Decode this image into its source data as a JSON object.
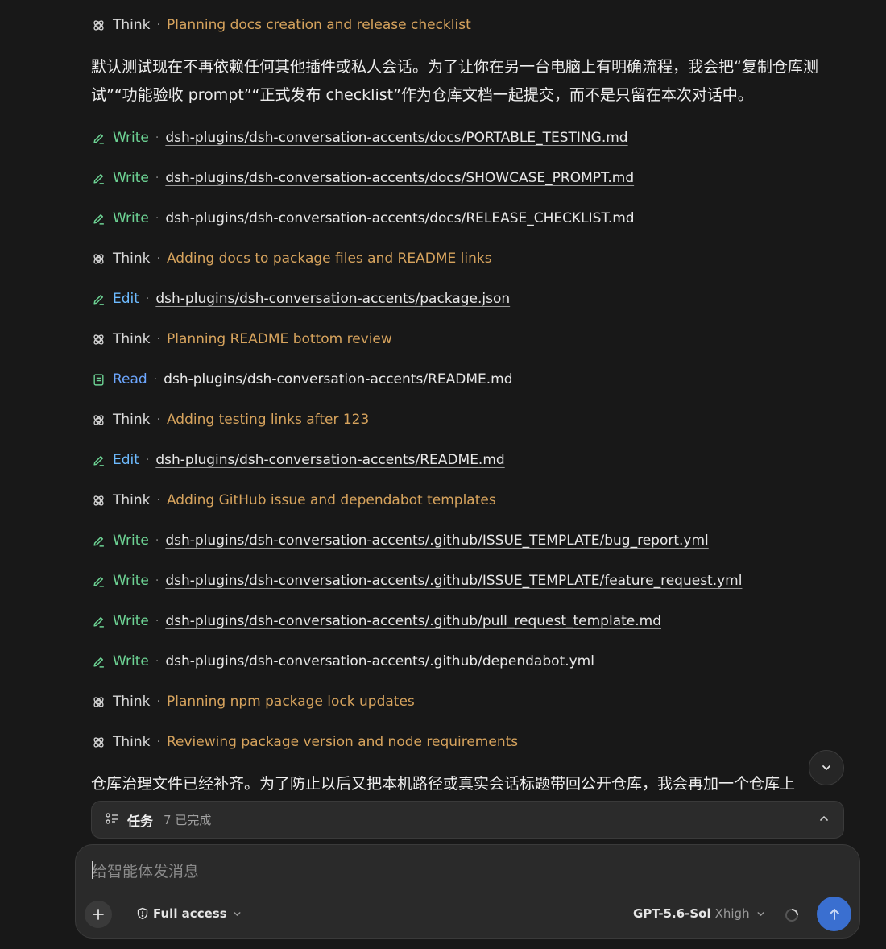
{
  "labels": {
    "write": "Write",
    "edit": "Edit",
    "read": "Read",
    "think": "Think",
    "sep": "·"
  },
  "log": {
    "top_think": "Planning docs creation and release checklist",
    "para1": "默认测试现在不再依赖任何其他插件或私人会话。为了让你在另一台电脑上有明确流程，我会把“复制仓库测试”“功能验收 prompt”“正式发布 checklist”作为仓库文档一起提交，而不是只留在本次对话中。",
    "items": [
      {
        "verb": "Write",
        "text": "dsh-plugins/dsh-conversation-accents/docs/PORTABLE_TESTING.md"
      },
      {
        "verb": "Write",
        "text": "dsh-plugins/dsh-conversation-accents/docs/SHOWCASE_PROMPT.md"
      },
      {
        "verb": "Write",
        "text": "dsh-plugins/dsh-conversation-accents/docs/RELEASE_CHECKLIST.md"
      },
      {
        "verb": "Think",
        "text": "Adding docs to package files and README links"
      },
      {
        "verb": "Edit",
        "text": "dsh-plugins/dsh-conversation-accents/package.json"
      },
      {
        "verb": "Think",
        "text": "Planning README bottom review"
      },
      {
        "verb": "Read",
        "text": "dsh-plugins/dsh-conversation-accents/README.md"
      },
      {
        "verb": "Think",
        "text": "Adding testing links after 123"
      },
      {
        "verb": "Edit",
        "text": "dsh-plugins/dsh-conversation-accents/README.md"
      },
      {
        "verb": "Think",
        "text": "Adding GitHub issue and dependabot templates"
      },
      {
        "verb": "Write",
        "text": "dsh-plugins/dsh-conversation-accents/.github/ISSUE_TEMPLATE/bug_report.yml"
      },
      {
        "verb": "Write",
        "text": "dsh-plugins/dsh-conversation-accents/.github/ISSUE_TEMPLATE/feature_request.yml"
      },
      {
        "verb": "Write",
        "text": "dsh-plugins/dsh-conversation-accents/.github/pull_request_template.md"
      },
      {
        "verb": "Write",
        "text": "dsh-plugins/dsh-conversation-accents/.github/dependabot.yml"
      },
      {
        "verb": "Think",
        "text": "Planning npm package lock updates"
      },
      {
        "verb": "Think",
        "text": "Reviewing package version and node requirements"
      }
    ],
    "para2": "仓库治理文件已经补齐。为了防止以后又把本机路径或真实会话标题带回公开仓库，我会再加一个仓库上"
  },
  "tasks": {
    "label": "任务",
    "count": "7 已完成"
  },
  "composer": {
    "placeholder": "给智能体发消息",
    "access": "Full access",
    "model": "GPT-5.6-Sol",
    "effort": "Xhigh"
  },
  "colors": {
    "write": "#6dd394",
    "edit": "#6dbbff",
    "think": "#d6a35d",
    "send": "#3a6fd0",
    "background": "#181818"
  }
}
